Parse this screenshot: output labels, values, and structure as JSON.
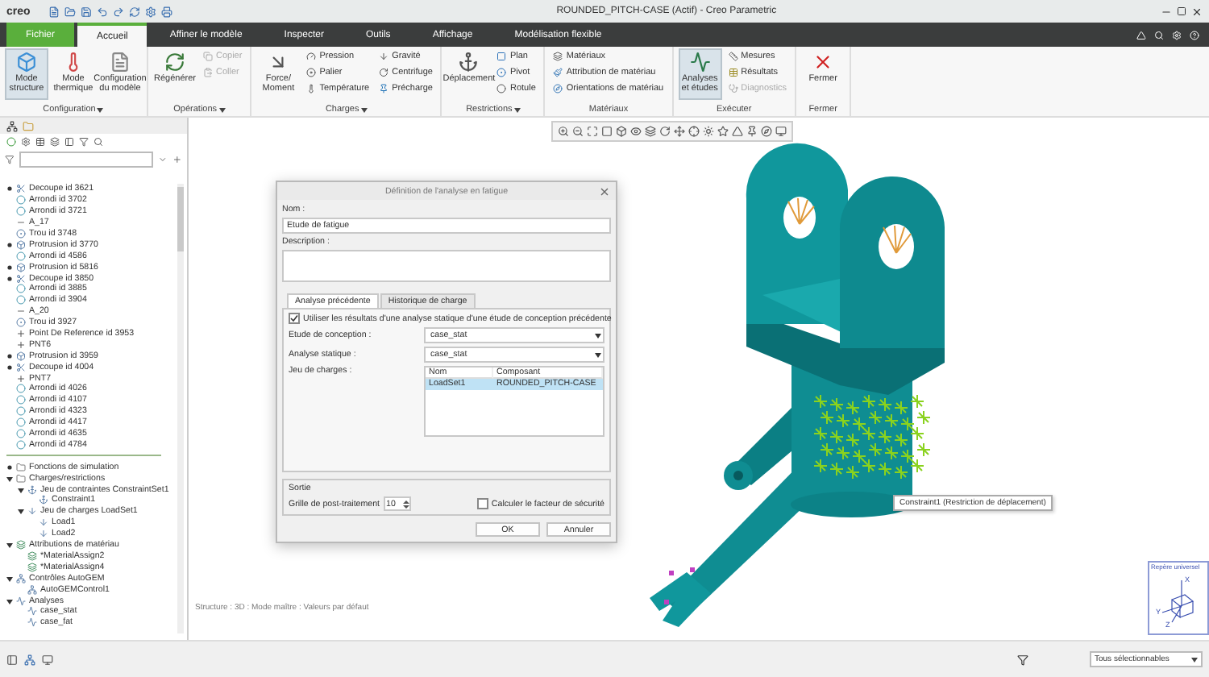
{
  "window": {
    "brand": "creo",
    "title": "ROUNDED_PITCH-CASE (Actif) - Creo Parametric"
  },
  "ribbon_tabs": [
    {
      "label": "Fichier",
      "kind": "file",
      "selected": false
    },
    {
      "label": "Accueil",
      "kind": "tab",
      "selected": true
    },
    {
      "label": "Affiner le modèle",
      "kind": "tab",
      "selected": false
    },
    {
      "label": "Inspecter",
      "kind": "tab",
      "selected": false
    },
    {
      "label": "Outils",
      "kind": "tab",
      "selected": false
    },
    {
      "label": "Affichage",
      "kind": "tab",
      "selected": false
    },
    {
      "label": "Modélisation flexible",
      "kind": "tab",
      "selected": false
    }
  ],
  "ribbon_groups": [
    {
      "label": "Configuration",
      "dropdown": true,
      "items": [
        {
          "label": "Mode structure",
          "kind": "large",
          "selected": true,
          "disabled": false
        },
        {
          "label": "Mode thermique",
          "kind": "large",
          "selected": false,
          "disabled": false
        },
        {
          "label": "Configuration du modèle",
          "kind": "large",
          "selected": false,
          "disabled": false
        }
      ]
    },
    {
      "label": "Opérations",
      "dropdown": true,
      "items": [
        {
          "label": "Régénérer",
          "kind": "large",
          "selected": false,
          "disabled": false
        },
        {
          "label": "Copier",
          "kind": "small",
          "selected": false,
          "disabled": true
        },
        {
          "label": "Coller",
          "kind": "small",
          "selected": false,
          "disabled": true
        }
      ]
    },
    {
      "label": "Charges",
      "dropdown": true,
      "items": [
        {
          "label": "Force/ Moment",
          "kind": "large",
          "selected": false,
          "disabled": false
        },
        {
          "label": "Pression",
          "kind": "small",
          "selected": false,
          "disabled": false
        },
        {
          "label": "Palier",
          "kind": "small",
          "selected": false,
          "disabled": false
        },
        {
          "label": "Température",
          "kind": "small",
          "selected": false,
          "disabled": false
        },
        {
          "label": "Gravité",
          "kind": "small",
          "selected": false,
          "disabled": false
        },
        {
          "label": "Centrifuge",
          "kind": "small",
          "selected": false,
          "disabled": false
        },
        {
          "label": "Précharge",
          "kind": "small",
          "selected": false,
          "disabled": false
        }
      ]
    },
    {
      "label": "Restrictions",
      "dropdown": true,
      "items": [
        {
          "label": "Déplacement",
          "kind": "large",
          "selected": false,
          "disabled": false
        },
        {
          "label": "Plan",
          "kind": "small",
          "selected": false,
          "disabled": false
        },
        {
          "label": "Pivot",
          "kind": "small",
          "selected": false,
          "disabled": false
        },
        {
          "label": "Rotule",
          "kind": "small",
          "selected": false,
          "disabled": false
        }
      ]
    },
    {
      "label": "Matériaux",
      "dropdown": false,
      "items": [
        {
          "label": "Matériaux",
          "kind": "small",
          "selected": false,
          "disabled": false
        },
        {
          "label": "Attribution de matériau",
          "kind": "small",
          "selected": false,
          "disabled": false
        },
        {
          "label": "Orientations de matériau",
          "kind": "small",
          "selected": false,
          "disabled": false
        }
      ]
    },
    {
      "label": "Exécuter",
      "dropdown": false,
      "items": [
        {
          "label": "Analyses et études",
          "kind": "large",
          "selected": true,
          "disabled": false
        },
        {
          "label": "Mesures",
          "kind": "small",
          "selected": false,
          "disabled": false
        },
        {
          "label": "Résultats",
          "kind": "small",
          "selected": false,
          "disabled": false
        },
        {
          "label": "Diagnostics",
          "kind": "small",
          "selected": false,
          "disabled": true
        }
      ]
    },
    {
      "label": "Fermer",
      "dropdown": false,
      "items": [
        {
          "label": "Fermer",
          "kind": "large",
          "selected": false,
          "disabled": false
        }
      ]
    }
  ],
  "model_tree": {
    "features": [
      {
        "label": "Decoupe id 3621",
        "kind": "cut",
        "expanded": false
      },
      {
        "label": "Arrondi id 3702",
        "kind": "round"
      },
      {
        "label": "Arrondi id 3721",
        "kind": "round"
      },
      {
        "label": "A_17",
        "kind": "axis"
      },
      {
        "label": "Trou id 3748",
        "kind": "hole"
      },
      {
        "label": "Protrusion id 3770",
        "kind": "protrusion",
        "expanded": false
      },
      {
        "label": "Arrondi id 4586",
        "kind": "round"
      },
      {
        "label": "Protrusion id 5816",
        "kind": "protrusion",
        "expanded": false
      },
      {
        "label": "Decoupe id 3850",
        "kind": "cut",
        "expanded": false
      },
      {
        "label": "Arrondi id 3885",
        "kind": "round"
      },
      {
        "label": "Arrondi id 3904",
        "kind": "round"
      },
      {
        "label": "A_20",
        "kind": "axis"
      },
      {
        "label": "Trou id 3927",
        "kind": "hole"
      },
      {
        "label": "Point De Reference id 3953",
        "kind": "point"
      },
      {
        "label": "PNT6",
        "kind": "point"
      },
      {
        "label": "Protrusion id 3959",
        "kind": "protrusion",
        "expanded": false
      },
      {
        "label": "Decoupe id 4004",
        "kind": "cut",
        "expanded": false
      },
      {
        "label": "PNT7",
        "kind": "point"
      },
      {
        "label": "Arrondi id 4026",
        "kind": "round"
      },
      {
        "label": "Arrondi id 4107",
        "kind": "round"
      },
      {
        "label": "Arrondi id 4323",
        "kind": "round"
      },
      {
        "label": "Arrondi id 4417",
        "kind": "round"
      },
      {
        "label": "Arrondi id 4635",
        "kind": "round"
      },
      {
        "label": "Arrondi id 4784",
        "kind": "round"
      }
    ],
    "simulation": [
      {
        "label": "Fonctions de simulation",
        "kind": "folder",
        "expanded": false
      },
      {
        "label": "Charges/restrictions",
        "kind": "folder",
        "expanded": true,
        "children": [
          {
            "label": "Jeu de contraintes ConstraintSet1",
            "kind": "constraint",
            "expanded": true,
            "children": [
              {
                "label": "Constraint1",
                "kind": "constraint"
              }
            ]
          },
          {
            "label": "Jeu de charges LoadSet1",
            "kind": "load",
            "expanded": true,
            "children": [
              {
                "label": "Load1",
                "kind": "load"
              },
              {
                "label": "Load2",
                "kind": "load"
              }
            ]
          }
        ]
      },
      {
        "label": "Attributions de matériau",
        "kind": "material",
        "expanded": true,
        "children": [
          {
            "label": "*MaterialAssign2",
            "kind": "material"
          },
          {
            "label": "*MaterialAssign4",
            "kind": "material"
          }
        ]
      },
      {
        "label": "Contrôles AutoGEM",
        "kind": "control",
        "expanded": true,
        "children": [
          {
            "label": "AutoGEMControl1",
            "kind": "control"
          }
        ]
      },
      {
        "label": "Analyses",
        "kind": "analysis",
        "expanded": true,
        "children": [
          {
            "label": "case_stat",
            "kind": "analysis"
          },
          {
            "label": "case_fat",
            "kind": "analysis"
          }
        ]
      }
    ]
  },
  "dialog": {
    "title": "Définition de l'analyse en fatigue",
    "name_label": "Nom :",
    "name_value": "Etude de fatigue",
    "description_label": "Description :",
    "tabs": [
      {
        "label": "Analyse précédente",
        "selected": true
      },
      {
        "label": "Historique de charge",
        "selected": false
      }
    ],
    "use_previous": {
      "label": "Utiliser les résultats d'une analyse statique d'une étude de conception précédente",
      "checked": true
    },
    "fields": [
      {
        "label": "Etude de conception :",
        "value": "case_stat"
      },
      {
        "label": "Analyse statique :",
        "value": "case_stat"
      }
    ],
    "load_sets": {
      "label": "Jeu de charges :",
      "columns": [
        "Nom",
        "Composant"
      ],
      "rows": [
        {
          "cells": [
            "LoadSet1",
            "ROUNDED_PITCH-CASE"
          ],
          "selected": true
        }
      ]
    },
    "output": {
      "title": "Sortie",
      "grid_label": "Grille de post-traitement",
      "grid_value": "10",
      "safety": {
        "label": "Calculer le facteur de sécurité",
        "checked": false
      }
    },
    "buttons": [
      "OK",
      "Annuler"
    ]
  },
  "graphics": {
    "tooltip": "Constraint1 (Restriction de déplacement)",
    "status_text": "Structure : 3D : Mode maître : Valeurs par défaut",
    "csys": {
      "label": "Repère universel",
      "axes": [
        "X",
        "Y",
        "Z"
      ]
    }
  },
  "status_bar": {
    "selection_filter": "Tous sélectionnables"
  }
}
